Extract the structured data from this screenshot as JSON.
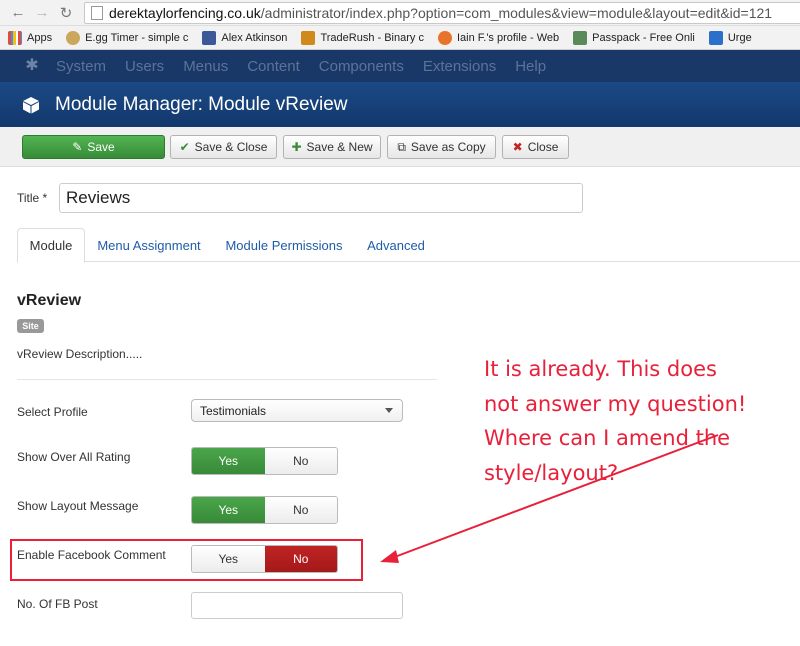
{
  "browser": {
    "url_domain": "derektaylorfencing.co.uk",
    "url_path": "/administrator/index.php?option=com_modules&view=module&layout=edit&id=121",
    "bookmarks": [
      {
        "label": "Apps",
        "icon": "apps-grid-icon",
        "color": "#e04b3a"
      },
      {
        "label": "E.gg Timer - simple c",
        "icon": "egg-timer-icon",
        "color": "#caa75a"
      },
      {
        "label": "Alex Atkinson",
        "icon": "facebook-icon",
        "color": "#3b5998"
      },
      {
        "label": "TradeRush - Binary c",
        "icon": "traderush-icon",
        "color": "#d08a1c"
      },
      {
        "label": "Iain F.'s profile - Web",
        "icon": "profile-icon",
        "color": "#e8732a"
      },
      {
        "label": "Passpack - Free Onli",
        "icon": "passpack-icon",
        "color": "#5a8a5a"
      },
      {
        "label": "Urge",
        "icon": "urge-icon",
        "color": "#2a6fc9"
      }
    ]
  },
  "topmenu": {
    "items": [
      "System",
      "Users",
      "Menus",
      "Content",
      "Components",
      "Extensions",
      "Help"
    ]
  },
  "header": {
    "title": "Module Manager: Module vReview"
  },
  "toolbar": {
    "save": "Save",
    "save_close": "Save & Close",
    "save_new": "Save & New",
    "save_copy": "Save as Copy",
    "close": "Close"
  },
  "form": {
    "title_label": "Title *",
    "title_value": "Reviews",
    "tabs": [
      "Module",
      "Menu Assignment",
      "Module Permissions",
      "Advanced"
    ],
    "module_name": "vReview",
    "badge": "Site",
    "description": "vReview Description.....",
    "select_profile_label": "Select Profile",
    "select_profile_value": "Testimonials",
    "overall_rating_label": "Show Over All Rating",
    "layout_message_label": "Show Layout Message",
    "fb_comment_label": "Enable Facebook Comment",
    "fb_post_label": "No. Of FB Post",
    "yes": "Yes",
    "no": "No"
  },
  "annotation": {
    "lines": [
      "It is already. This does",
      "not answer my question!",
      "Where can I amend the",
      "style/layout?"
    ],
    "color": "#e8203a"
  }
}
